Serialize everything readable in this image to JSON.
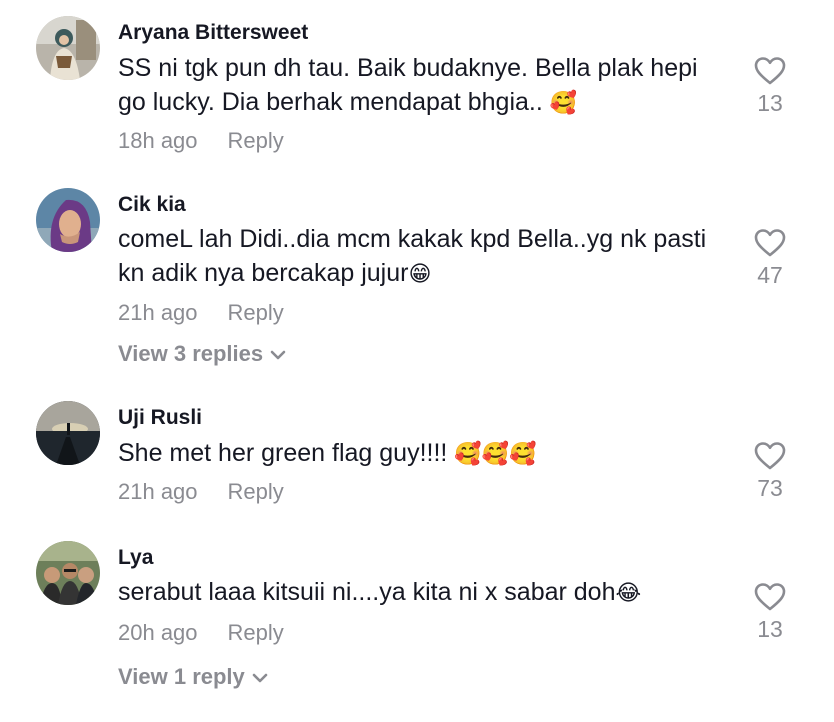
{
  "comments": [
    {
      "username": "Aryana Bittersweet",
      "text": "SS ni tgk pun dh tau. Baik budaknye. Bella plak hepi go lucky. Dia berhak mendapat bhgia.. ",
      "emoji": "🥰",
      "time": "18h ago",
      "reply_label": "Reply",
      "likes": "13",
      "avatar_icon": "avatar-photo-hijab-woman"
    },
    {
      "username": "Cik kia",
      "text": "comeL lah Didi..dia mcm kakak kpd Bella..yg nk pasti kn adik nya bercakap jujur",
      "emoji": "😁",
      "time": "21h ago",
      "reply_label": "Reply",
      "likes": "47",
      "view_replies": "View 3 replies",
      "avatar_icon": "avatar-photo-purple-hijab"
    },
    {
      "username": "Uji Rusli",
      "text": "She met her green flag guy!!!! ",
      "emoji": "🥰🥰🥰",
      "time": "21h ago",
      "reply_label": "Reply",
      "likes": "73",
      "avatar_icon": "avatar-photo-sunset-pier"
    },
    {
      "username": "Lya",
      "text": "serabut laaa kitsuii ni....ya kita ni x sabar doh",
      "emoji": "😂",
      "time": "20h ago",
      "reply_label": "Reply",
      "likes": "13",
      "view_replies": "View 1 reply",
      "avatar_icon": "avatar-photo-group"
    }
  ],
  "colors": {
    "text": "#161823",
    "muted": "#8a8b91",
    "heart_stroke": "#8a8b91"
  }
}
